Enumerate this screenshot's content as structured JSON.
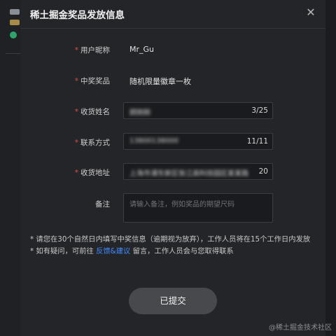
{
  "modal": {
    "title": "稀土掘金奖品发放信息",
    "close_icon": "✕"
  },
  "form": {
    "nickname": {
      "label": "用户昵称",
      "required": "*",
      "value": "Mr_Gu"
    },
    "prize": {
      "label": "中奖奖品",
      "required": "*",
      "value": "随机限量徽章一枚"
    },
    "receiver_name": {
      "label": "收货姓名",
      "required": "*",
      "value": "顾刚刚",
      "count": "3/25"
    },
    "contact": {
      "label": "联系方式",
      "required": "*",
      "value": "13800138000",
      "count": "11/11"
    },
    "address": {
      "label": "收货地址",
      "required": "*",
      "value": "上海市浦东新区张江高科技园区某某路某某号",
      "count": "20"
    },
    "remark": {
      "label": "备注",
      "placeholder": "请输入备注，例如奖品的期望尺码"
    }
  },
  "notes": {
    "line1": "* 请您在30个自然日内填写中奖信息（逾期视为放弃），工作人员将在15个工作日内发放",
    "line2_prefix": "* 如有疑问，可前往 ",
    "feedback_link": "反馈&建议",
    "line2_suffix": " 留言，工作人员会与您取得联系"
  },
  "submit_label": "已提交",
  "watermark": "@稀土掘金技术社区",
  "colors": {
    "accent": "#3f8cff",
    "required": "#e04b4b",
    "background": "#242529"
  }
}
